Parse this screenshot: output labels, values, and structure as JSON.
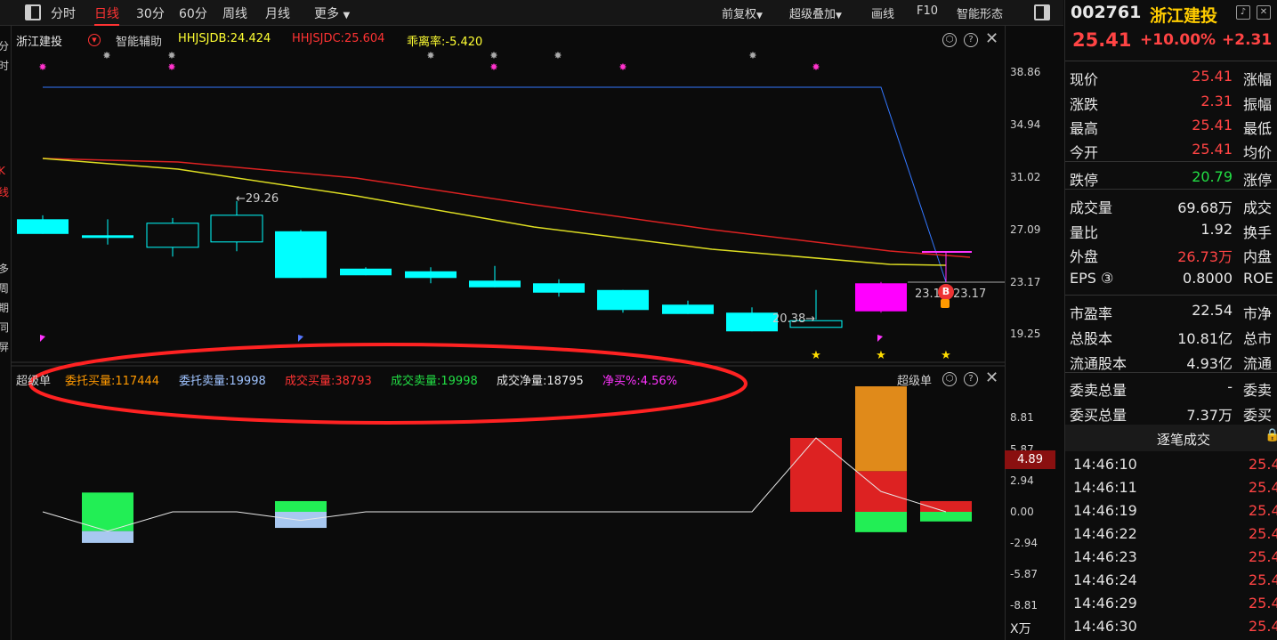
{
  "toolbar": {
    "period_tabs": [
      "分时",
      "日线",
      "30分",
      "60分",
      "周线",
      "月线",
      "更多"
    ],
    "active_tab": "日线",
    "right_items": [
      "前复权",
      "超级叠加",
      "画线",
      "F10",
      "智能形态"
    ]
  },
  "left_strip_chars": [
    "分",
    "时",
    "K",
    "线",
    "多",
    "周",
    "期",
    "同",
    "屏"
  ],
  "main_chart": {
    "stock_name": "浙江建投",
    "assist_label": "智能辅助",
    "indicators": [
      {
        "text": "HHJSJDB:24.424",
        "color": "#ffff33"
      },
      {
        "text": "HHJSJDC:25.604",
        "color": "#ff3333"
      },
      {
        "text": "乖离率:-5.420",
        "color": "#ffff33"
      }
    ],
    "y_ticks": [
      "38.86",
      "34.94",
      "31.02",
      "27.09",
      "23.17",
      "19.25"
    ],
    "annotations": {
      "high": "29.26",
      "low": "20.38",
      "price_a": "23.17",
      "price_b": "23.17"
    },
    "candles": [
      {
        "o": 27.9,
        "c": 26.8,
        "h": 28.2,
        "l": 26.8
      },
      {
        "o": 26.7,
        "c": 26.5,
        "h": 27.9,
        "l": 26.0
      },
      {
        "o": 25.8,
        "c": 27.6,
        "h": 28.0,
        "l": 25.1
      },
      {
        "o": 26.2,
        "c": 28.2,
        "h": 29.26,
        "l": 25.5
      },
      {
        "o": 27.0,
        "c": 23.5,
        "h": 27.1,
        "l": 23.5
      },
      {
        "o": 24.2,
        "c": 23.7,
        "h": 24.3,
        "l": 23.7
      },
      {
        "o": 24.0,
        "c": 23.5,
        "h": 24.3,
        "l": 23.1
      },
      {
        "o": 23.3,
        "c": 22.8,
        "h": 24.4,
        "l": 22.8
      },
      {
        "o": 23.1,
        "c": 22.4,
        "h": 23.4,
        "l": 22.1
      },
      {
        "o": 22.6,
        "c": 21.1,
        "h": 22.6,
        "l": 20.9
      },
      {
        "o": 21.5,
        "c": 20.8,
        "h": 21.8,
        "l": 20.8
      },
      {
        "o": 20.9,
        "c": 19.5,
        "h": 21.3,
        "l": 19.5
      },
      {
        "o": 19.8,
        "c": 20.3,
        "h": 22.6,
        "l": 20.38
      },
      {
        "o": 21.0,
        "c": 23.1,
        "h": 23.2,
        "l": 20.9
      },
      {
        "o": 25.41,
        "c": 25.41,
        "h": 25.41,
        "l": 23.17
      }
    ],
    "x_start_price": 38.3
  },
  "sub_chart": {
    "name": "超级单",
    "legend": [
      {
        "text": "委托买量:117444",
        "color": "#ff9900"
      },
      {
        "text": "委托卖量:19998",
        "color": "#9fc3ff"
      },
      {
        "text": "成交买量:38793",
        "color": "#ff3333"
      },
      {
        "text": "成交卖量:19998",
        "color": "#22dd44"
      },
      {
        "text": "成交净量:18795",
        "color": "#e8e8e8"
      },
      {
        "text": "净买%:4.56%",
        "color": "#ff33ff"
      }
    ],
    "y_ticks": [
      "8.81",
      "5.87",
      "2.94",
      "0.00",
      "-2.94",
      "-5.87",
      "-8.81"
    ],
    "current_value": "4.89",
    "unit": "X万"
  },
  "quote": {
    "code": "002761",
    "name": "浙江建投",
    "price": "25.41",
    "change_pct": "+10.00%",
    "change": "+2.31",
    "rows": [
      {
        "k": "现价",
        "v": "25.41",
        "c": "red",
        "k2": "涨幅"
      },
      {
        "k": "涨跌",
        "v": "2.31",
        "c": "red",
        "k2": "振幅"
      },
      {
        "k": "最高",
        "v": "25.41",
        "c": "red",
        "k2": "最低"
      },
      {
        "k": "今开",
        "v": "25.41",
        "c": "red",
        "k2": "均价"
      },
      {
        "k": "跌停",
        "v": "20.79",
        "c": "green",
        "k2": "涨停"
      },
      {
        "k": "成交量",
        "v": "69.68万",
        "c": "white",
        "k2": "成交"
      },
      {
        "k": "量比",
        "v": "1.92",
        "c": "white",
        "k2": "换手"
      },
      {
        "k": "外盘",
        "v": "26.73万",
        "c": "red",
        "k2": "内盘"
      },
      {
        "k": "EPS ③",
        "v": "0.8000",
        "c": "white",
        "k2": "ROE"
      },
      {
        "k": "市盈率",
        "v": "22.54",
        "c": "white",
        "k2": "市净"
      },
      {
        "k": "总股本",
        "v": "10.81亿",
        "c": "white",
        "k2": "总市"
      },
      {
        "k": "流通股本",
        "v": "4.93亿",
        "c": "white",
        "k2": "流通"
      },
      {
        "k": "委卖总量",
        "v": "-",
        "c": "white",
        "k2": "委卖"
      },
      {
        "k": "委买总量",
        "v": "7.37万",
        "c": "white",
        "k2": "委买"
      }
    ],
    "trades_title": "逐笔成交",
    "trades": [
      {
        "t": "14:46:10",
        "p": "25.4"
      },
      {
        "t": "14:46:11",
        "p": "25.4"
      },
      {
        "t": "14:46:19",
        "p": "25.4"
      },
      {
        "t": "14:46:22",
        "p": "25.4"
      },
      {
        "t": "14:46:23",
        "p": "25.4"
      },
      {
        "t": "14:46:24",
        "p": "25.4"
      },
      {
        "t": "14:46:29",
        "p": "25.4"
      },
      {
        "t": "14:46:30",
        "p": "25.4"
      }
    ]
  }
}
